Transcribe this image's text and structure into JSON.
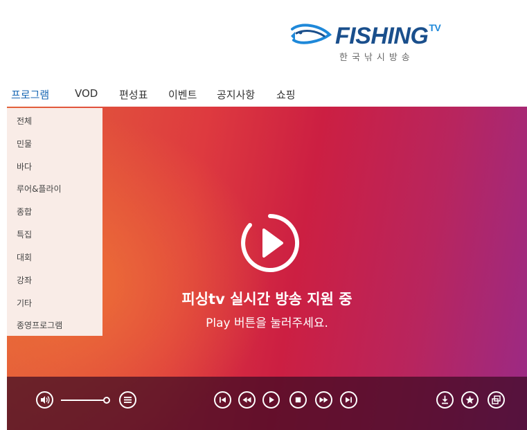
{
  "logo": {
    "brand": "FISHING",
    "brand_sup": "TV",
    "subtitle": "한국낚시방송"
  },
  "nav": {
    "items": [
      {
        "label": "프로그램"
      },
      {
        "label": "VOD"
      },
      {
        "label": "편성표"
      },
      {
        "label": "이벤트"
      },
      {
        "label": "공지사항"
      },
      {
        "label": "쇼핑"
      }
    ],
    "active_index": 0
  },
  "dropdown": {
    "items": [
      {
        "label": "전체"
      },
      {
        "label": "민물"
      },
      {
        "label": "바다"
      },
      {
        "label": "루어&플라이"
      },
      {
        "label": "종합"
      },
      {
        "label": "특집"
      },
      {
        "label": "대회"
      },
      {
        "label": "강좌"
      },
      {
        "label": "기타"
      },
      {
        "label": "종영프로그램"
      }
    ]
  },
  "player": {
    "live_text": "피싱tv 실시간 방송 지원 중",
    "sub_text": "Play 버튼을 눌러주세요.",
    "controls": {
      "left": [
        "volume-icon",
        "playlist-icon"
      ],
      "center": [
        "skip-previous-icon",
        "rewind-icon",
        "play-icon",
        "stop-icon",
        "fast-forward-icon",
        "skip-next-icon"
      ],
      "right": [
        "download-icon",
        "favorite-star-icon",
        "popup-window-icon"
      ]
    }
  },
  "colors": {
    "brand_blue": "#1a4f8c",
    "nav_active": "#1766b3",
    "dropdown_bg": "#f9ece7"
  }
}
